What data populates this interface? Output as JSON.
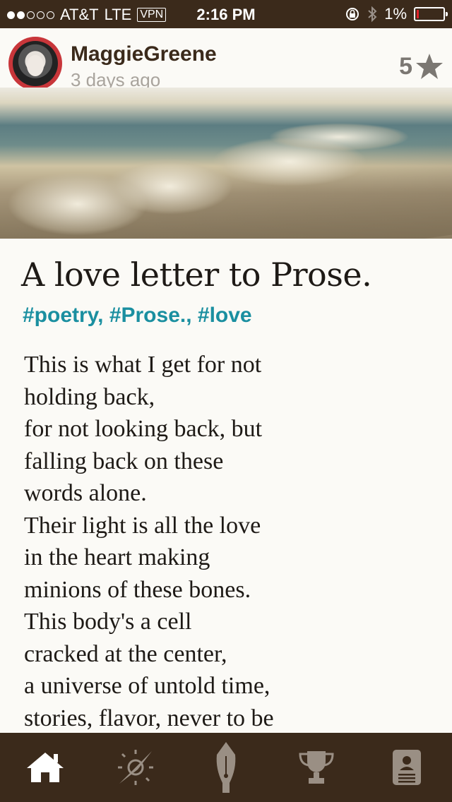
{
  "status_bar": {
    "carrier": "AT&T",
    "network": "LTE",
    "vpn": "VPN",
    "time": "2:16 PM",
    "battery": "1%",
    "signal_bars_filled": 2,
    "signal_bars_total": 5
  },
  "post": {
    "author": "MaggieGreene",
    "posted": "3 days ago",
    "rating": "5",
    "title": "A love letter to Prose.",
    "tags": "#poetry, #Prose., #love",
    "lines": [
      "This is what I get for not",
      "holding back,",
      "for not looking back, but",
      "falling back on these",
      "words alone.",
      "Their light is all the love",
      "in the heart making",
      "minions of these bones.",
      "This body's a cell",
      "cracked at the center,",
      "a universe of untold time,",
      "stories, flavor, never to be"
    ]
  },
  "tabs": [
    {
      "icon": "home-icon",
      "active": true
    },
    {
      "icon": "compass-icon",
      "active": false
    },
    {
      "icon": "pen-nib-icon",
      "active": false
    },
    {
      "icon": "trophy-icon",
      "active": false
    },
    {
      "icon": "profile-icon",
      "active": false
    }
  ],
  "colors": {
    "bar": "#3b2a1b",
    "tag": "#1a8fa0",
    "battery_low": "#e0232b"
  }
}
